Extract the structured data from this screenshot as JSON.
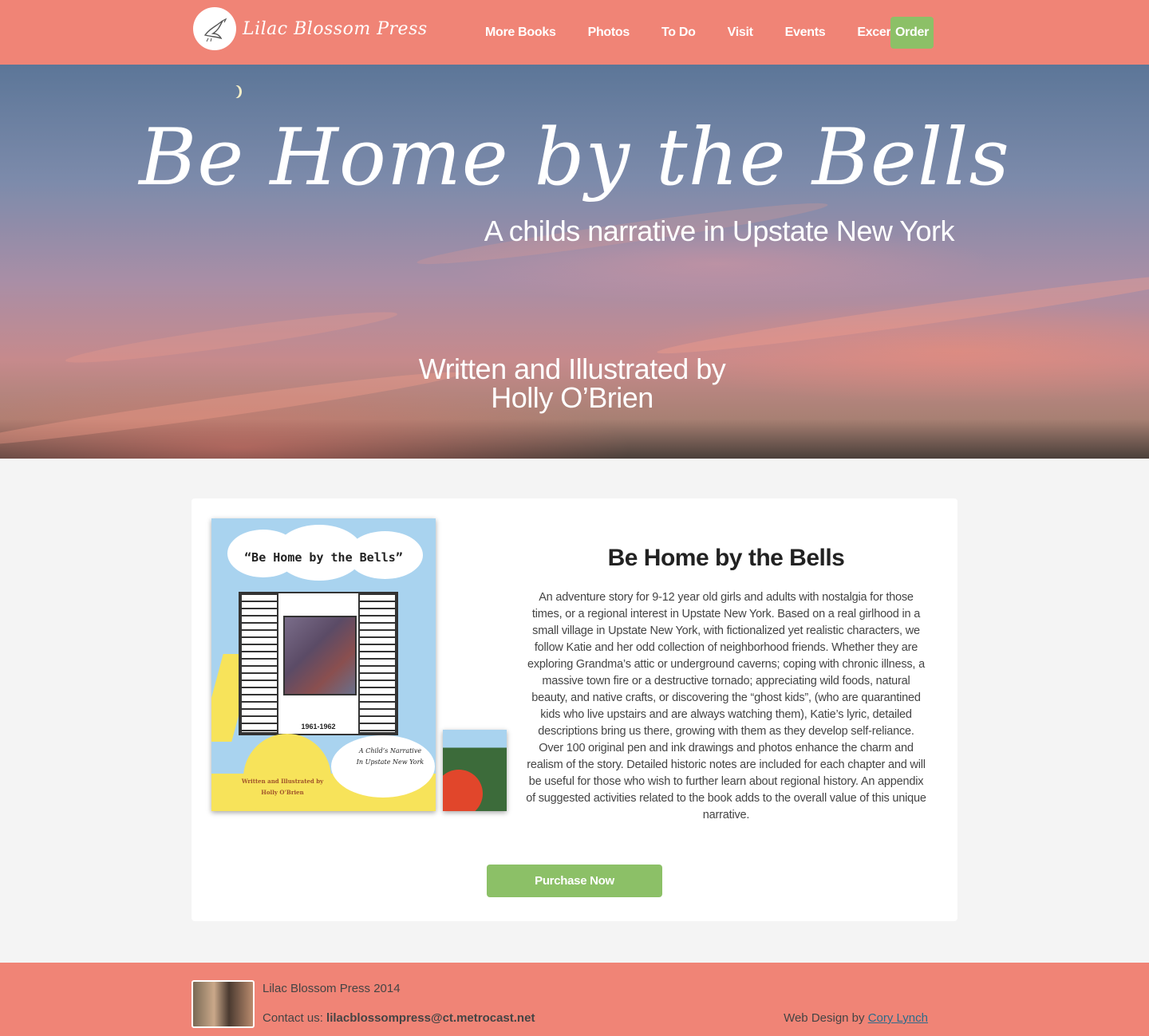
{
  "nav": {
    "brand": "Lilac Blossom Press",
    "links": [
      "More Books",
      "Photos",
      "To Do",
      "Visit",
      "Events",
      "Excerpts"
    ],
    "order": "Order"
  },
  "hero": {
    "title": "Be Home by the Bells",
    "subtitle": "A childs narrative in Upstate New York",
    "credit_line1": "Written and Illustrated by",
    "credit_line2": "Holly O’Brien"
  },
  "book": {
    "cover_title": "“Be Home by the Bells”",
    "cover_years": "1961-1962",
    "cover_subtitle_line1": "A Child’s Narrative",
    "cover_subtitle_line2": "In Upstate New York",
    "cover_credit_line1": "Written and Illustrated by",
    "cover_credit_line2": "Holly O’Brien",
    "title": "Be Home by the Bells",
    "description": "An adventure story for 9-12 year old girls and adults with nostalgia for those times, or a regional interest in Upstate New York. Based on a real girlhood in a small village in Upstate New York, with fictionalized yet realistic characters, we follow Katie and her odd collection of neighborhood friends. Whether they are exploring Grandma’s attic or underground caverns; coping with chronic illness, a massive town fire or a destructive tornado; appreciating wild foods, natural beauty, and native crafts, or discovering the “ghost kids”, (who are quarantined kids who live upstairs and are always watching them), Katie’s lyric, detailed descriptions bring us there, growing with them as they develop self-reliance. Over 100 original pen and ink drawings and photos enhance the charm and realism of the story. Detailed historic notes are included for each chapter and will be useful for those who wish to further learn about regional history. An appendix of suggested activities related to the book adds to the overall value of this unique narrative.",
    "purchase": "Purchase Now"
  },
  "footer": {
    "copyright": "Lilac Blossom Press 2014",
    "contact_label": "Contact us:",
    "contact_email": "lilacblossompress@ct.metrocast.net",
    "credit_label": "Web Design by",
    "credit_name": "Cory Lynch"
  },
  "colors": {
    "nav": "#f08476",
    "accent_green": "#8cc067",
    "page_bg": "#f4f4f4"
  }
}
